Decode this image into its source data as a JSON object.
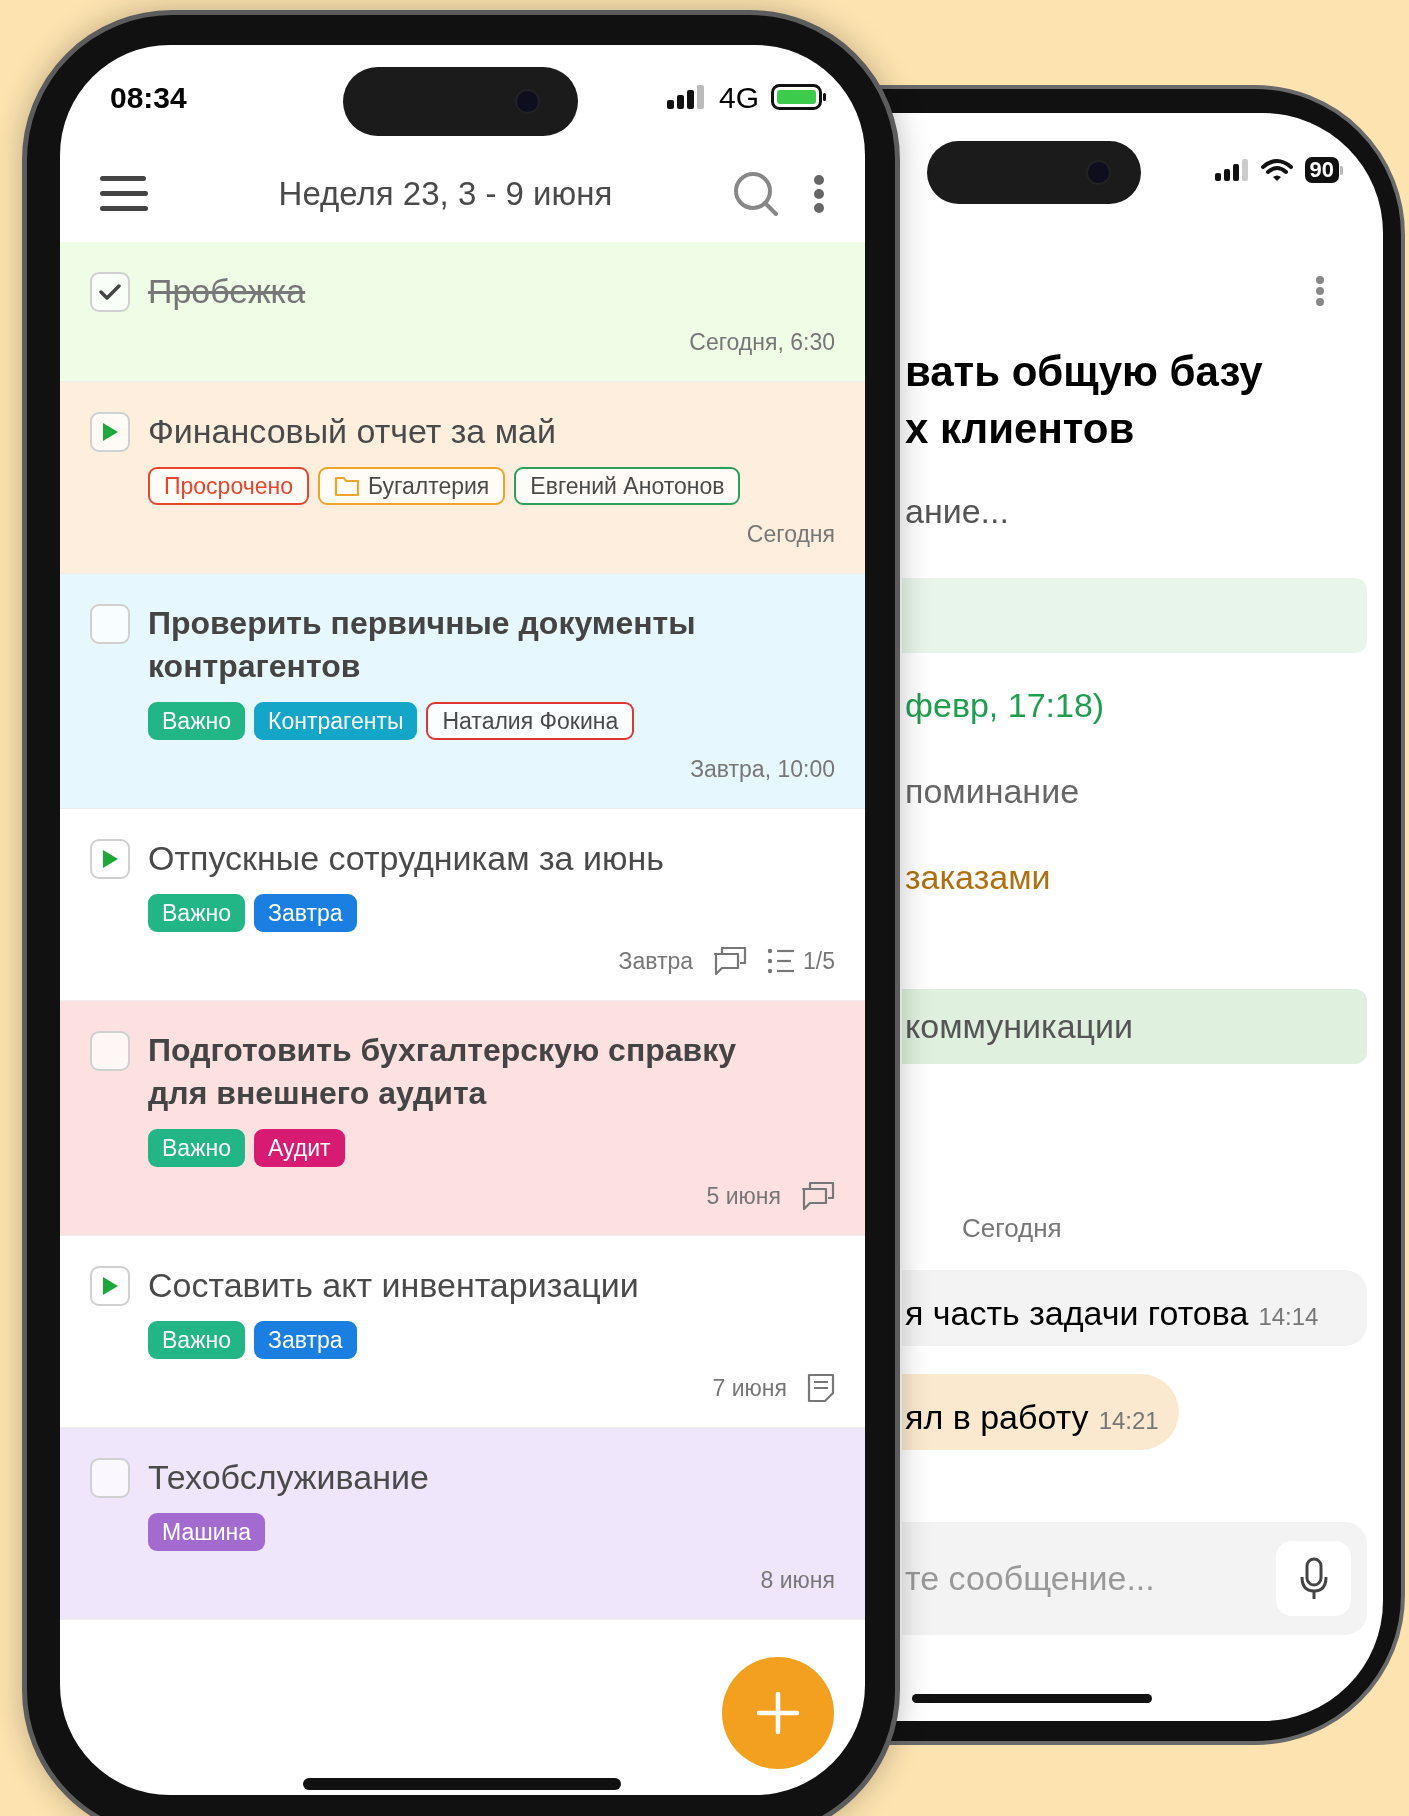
{
  "front_phone": {
    "status_bar": {
      "time": "08:34",
      "network": "4G"
    },
    "header": {
      "title": "Неделя 23, 3 - 9 июня"
    },
    "tasks": [
      {
        "title": "Пробежка",
        "checked": true,
        "started": false,
        "emphasis": false,
        "color": "#effce6",
        "meta": [
          {
            "kind": "text",
            "text": "Сегодня, 6:30"
          }
        ]
      },
      {
        "title": "Финансовый отчет за май",
        "checked": false,
        "started": true,
        "emphasis": false,
        "color": "#fdeedd",
        "tags": [
          {
            "kind": "alert",
            "text": "Просрочено",
            "color": "#e8452c"
          },
          {
            "kind": "folder",
            "text": "Бугалтерия",
            "color": "#f0a42a"
          },
          {
            "kind": "outline",
            "text": "Евгений Анотонов",
            "color": "#2e9e58"
          }
        ],
        "meta": [
          {
            "kind": "text",
            "text": "Сегодня"
          }
        ]
      },
      {
        "title": "Проверить первичные документы контрагентов",
        "checked": false,
        "started": false,
        "emphasis": true,
        "color": "#e6f8fd",
        "tags": [
          {
            "kind": "filled",
            "text": "Важно",
            "color": "#22b585"
          },
          {
            "kind": "filled",
            "text": "Контрагенты",
            "color": "#13a6c9"
          },
          {
            "kind": "outline",
            "text": "Наталия Фокина",
            "color": "#e03535"
          }
        ],
        "meta": [
          {
            "kind": "text",
            "text": "Завтра, 10:00"
          }
        ]
      },
      {
        "title": "Отпускные сотрудникам за июнь",
        "checked": false,
        "started": true,
        "emphasis": false,
        "color": "#ffffff",
        "tags": [
          {
            "kind": "filled",
            "text": "Важно",
            "color": "#22b585"
          },
          {
            "kind": "filled",
            "text": "Завтра",
            "color": "#1a7fe0"
          }
        ],
        "meta": [
          {
            "kind": "text",
            "text": "Завтра"
          },
          {
            "kind": "comments"
          },
          {
            "kind": "checklist",
            "text": "1/5"
          }
        ]
      },
      {
        "title": "Подготовить бухгалтерскую справку для внешнего аудита",
        "checked": false,
        "started": false,
        "emphasis": true,
        "color": "#fde0e0",
        "tags": [
          {
            "kind": "filled",
            "text": "Важно",
            "color": "#22b585"
          },
          {
            "kind": "filled",
            "text": "Аудит",
            "color": "#d81b72"
          }
        ],
        "meta": [
          {
            "kind": "text",
            "text": "5 июня"
          },
          {
            "kind": "comments"
          }
        ]
      },
      {
        "title": "Составить акт инвентаризации",
        "checked": false,
        "started": true,
        "emphasis": false,
        "color": "#ffffff",
        "tags": [
          {
            "kind": "filled",
            "text": "Важно",
            "color": "#22b585"
          },
          {
            "kind": "filled",
            "text": "Завтра",
            "color": "#1a7fe0"
          }
        ],
        "meta": [
          {
            "kind": "text",
            "text": "7 июня"
          },
          {
            "kind": "note"
          }
        ]
      },
      {
        "title": "Техобслуживание",
        "checked": false,
        "started": false,
        "emphasis": false,
        "color": "#efe6fb",
        "tags": [
          {
            "kind": "filled",
            "text": "Машина",
            "color": "#a36bd0"
          }
        ],
        "meta": [
          {
            "kind": "text",
            "text": "8 июня"
          }
        ]
      }
    ]
  },
  "back_phone": {
    "status_bar": {
      "battery": "90"
    },
    "title_lines": [
      "вать общую базу",
      "х клиентов"
    ],
    "description": "ание...",
    "deadline": "февр, 17:18)",
    "reminder": "поминание",
    "project": "заказами",
    "section": "коммуникации",
    "chat": {
      "date": "Сегодня",
      "messages": [
        {
          "kind": "incoming",
          "text": "я часть задачи готова",
          "time": "14:14"
        },
        {
          "kind": "outgoing",
          "text": "ял в работу",
          "time": "14:21"
        }
      ]
    },
    "message_input": {
      "placeholder": "те сообщение..."
    }
  }
}
